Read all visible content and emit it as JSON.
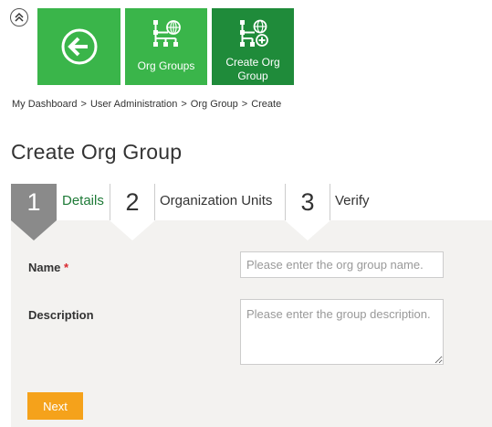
{
  "header": {
    "collapse_icon": "double-chevron-up-icon",
    "tiles": [
      {
        "label": "",
        "icon": "arrow-left-circle-icon",
        "color": "#3ab54a"
      },
      {
        "label": "Org Groups",
        "icon": "org-groups-icon",
        "color": "#3ab54a"
      },
      {
        "label": "Create Org Group",
        "icon": "create-org-group-icon",
        "color": "#1f8b3a"
      }
    ]
  },
  "breadcrumb": {
    "items": [
      "My Dashboard",
      "User Administration",
      "Org Group",
      "Create"
    ],
    "separator": ">"
  },
  "page": {
    "title": "Create Org Group"
  },
  "steps": [
    {
      "number": "1",
      "label": "Details",
      "active": true
    },
    {
      "number": "2",
      "label": "Organization Units",
      "active": false
    },
    {
      "number": "3",
      "label": "Verify",
      "active": false
    }
  ],
  "form": {
    "name_label": "Name",
    "required_marker": "*",
    "name_placeholder": "Please enter the org group name.",
    "name_value": "",
    "description_label": "Description",
    "description_placeholder": "Please enter the group description.",
    "description_value": "",
    "next_label": "Next"
  },
  "colors": {
    "tile_green": "#3ab54a",
    "tile_dark_green": "#1f8b3a",
    "step_active": "#8a8a8a",
    "panel_bg": "#f3f2f0",
    "next_button": "#f5a21b",
    "required": "#d9272e",
    "active_step_label": "#1e7a37"
  }
}
